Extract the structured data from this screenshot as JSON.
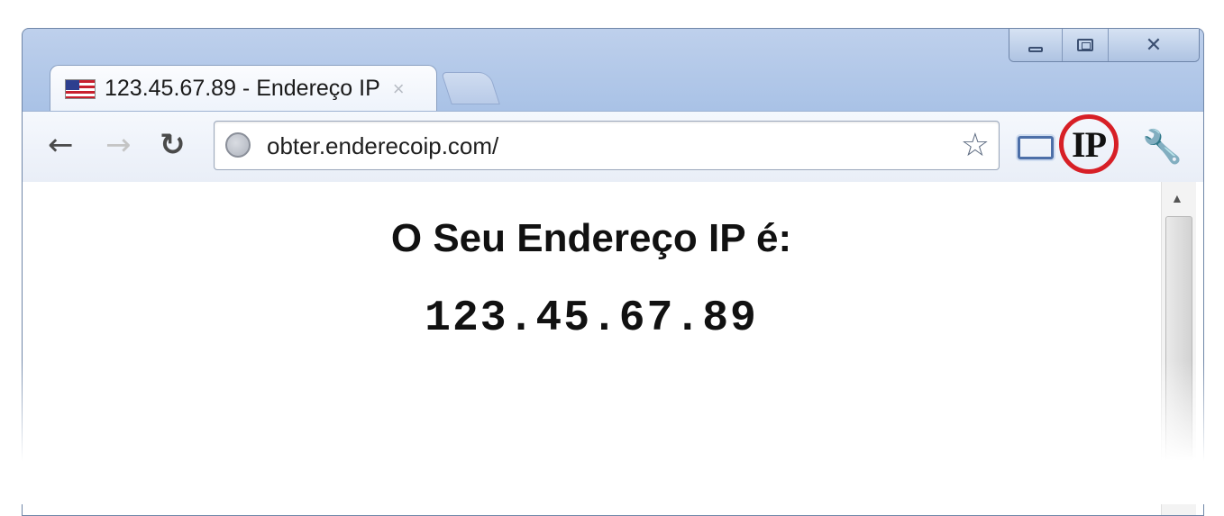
{
  "tab": {
    "title": "123.45.67.89 - Endereço IP",
    "close_glyph": "×",
    "flag_icon": "us-flag-icon"
  },
  "window_controls": {
    "minimize_icon": "minimize-icon",
    "maximize_icon": "maximize-icon",
    "close_glyph": "✕"
  },
  "toolbar": {
    "back_glyph": "←",
    "forward_glyph": "→",
    "reload_glyph": "↻",
    "url": "obter.enderecoip.com/",
    "star_glyph": "☆",
    "extension_label": "IP",
    "wrench_glyph": "🔧"
  },
  "page": {
    "heading": "O Seu Endereço IP é:",
    "ip_address": "123.45.67.89"
  },
  "colors": {
    "frame": "#a9c2e6",
    "highlight_ring": "#d71f26"
  }
}
